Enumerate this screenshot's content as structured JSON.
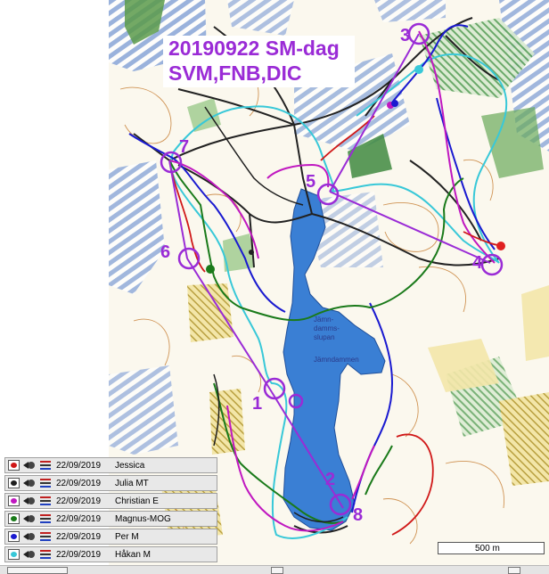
{
  "map": {
    "title_line1": "20190922 SM-dag",
    "title_line2": "SVM,FNB,DIC",
    "controls": [
      {
        "label": "3"
      },
      {
        "label": "5"
      },
      {
        "label": "7"
      },
      {
        "label": "6"
      },
      {
        "label": "4"
      },
      {
        "label": "1"
      },
      {
        "label": "2"
      },
      {
        "label": "8"
      }
    ],
    "place_names": [
      {
        "text": "Jämn-"
      },
      {
        "text": "damms-"
      },
      {
        "text": "slupan"
      },
      {
        "text": "Jämndammen"
      }
    ],
    "scale_label": "500 m",
    "route_colors": {
      "jessica": "#d01818",
      "julia": "#1e1e1e",
      "christian": "#c018c0",
      "magnus": "#1a7a1a",
      "per": "#1a1ad0",
      "hakan": "#38c8d8",
      "course": "#9a2bd6"
    }
  },
  "runners": [
    {
      "date": "22/09/2019",
      "name": "Jessica",
      "color": "#d01818"
    },
    {
      "date": "22/09/2019",
      "name": "Julia MT",
      "color": "#1e1e1e"
    },
    {
      "date": "22/09/2019",
      "name": "Christian E",
      "color": "#c018c0"
    },
    {
      "date": "22/09/2019",
      "name": "Magnus-MOG",
      "color": "#1a7a1a"
    },
    {
      "date": "22/09/2019",
      "name": "Per M",
      "color": "#1a1ad0"
    },
    {
      "date": "22/09/2019",
      "name": "Håkan M",
      "color": "#38c8d8"
    }
  ]
}
